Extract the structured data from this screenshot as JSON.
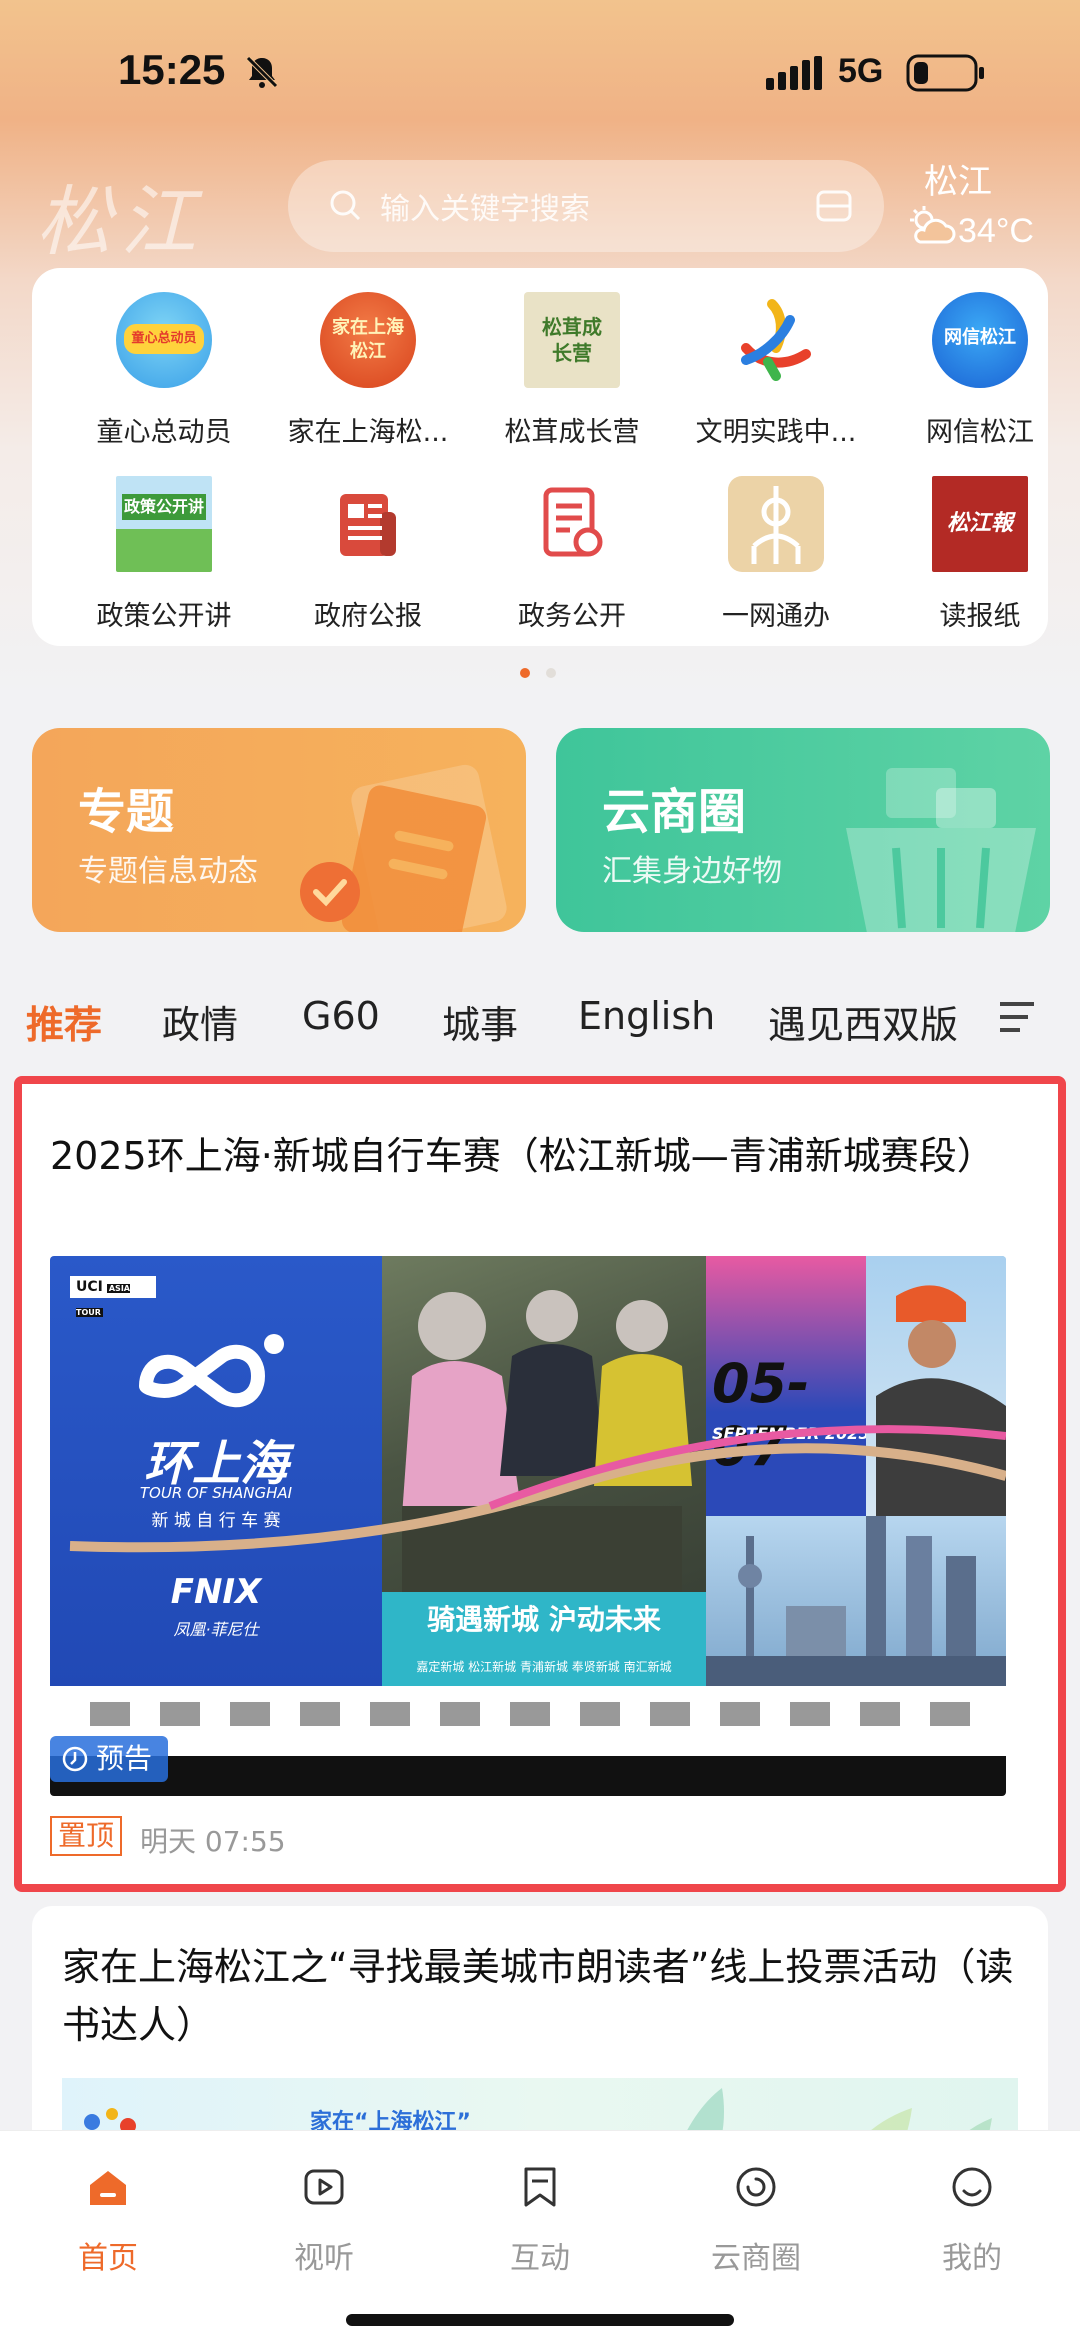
{
  "status_bar": {
    "time": "15:25",
    "network": "5G"
  },
  "header": {
    "logo_text": "松江",
    "search_placeholder": "输入关键字搜索",
    "weather": {
      "city": "松江",
      "temp": "34°C"
    }
  },
  "grid": {
    "items": [
      {
        "label": "童心总动员",
        "icon": "kids-icon"
      },
      {
        "label": "家在上海松...",
        "icon": "home-songjiang-icon"
      },
      {
        "label": "松茸成长营",
        "icon": "growth-camp-icon"
      },
      {
        "label": "文明实践中...",
        "icon": "civilization-icon"
      },
      {
        "label": "网信松江",
        "icon": "net-info-icon"
      },
      {
        "label": "政策公开讲",
        "icon": "policy-talk-icon"
      },
      {
        "label": "政府公报",
        "icon": "gov-bulletin-icon"
      },
      {
        "label": "政务公开",
        "icon": "gov-affairs-icon"
      },
      {
        "label": "一网通办",
        "icon": "one-net-icon"
      },
      {
        "label": "读报纸",
        "icon": "newspaper-icon"
      }
    ],
    "icon_texts": {
      "kids": "童心总动员",
      "home": "家在上海松江",
      "growth": "松茸成长营",
      "net": "网信松江",
      "policy": "政策公开讲",
      "newspaper": "松江報"
    }
  },
  "promos": {
    "left": {
      "title": "专题",
      "subtitle": "专题信息动态"
    },
    "right": {
      "title": "云商圈",
      "subtitle": "汇集身边好物"
    }
  },
  "tabs": {
    "items": [
      "推荐",
      "政情",
      "G60",
      "城事",
      "English",
      "遇见西双版"
    ],
    "active": "推荐"
  },
  "article1": {
    "title": "2025环上海·新城自行车赛（松江新城—青浦新城赛段）",
    "preview_label": "预告",
    "pin_label": "置顶",
    "time": "明天 07:55",
    "poster": {
      "uci": "UCI",
      "asia_tour": "ASIA TOUR",
      "brand": "环上海",
      "brand_en": "TOUR OF SHANGHAI",
      "sub": "新 城 自 行 车 赛",
      "sponsor": "FNIX",
      "sponsor_cn": "凤凰·菲尼仕",
      "date": "05-07",
      "month": "SEPTEMBER 2025",
      "slogan": "骑遇新城  沪动未来",
      "districts": "嘉定新城  松江新城  青浦新城  奉贤新城  南汇新城"
    }
  },
  "article2": {
    "title": "家在上海松江之“寻找最美城市朗读者”线上投票活动（读书达人）",
    "image_caption": "家在“上海松江”"
  },
  "bottom_nav": {
    "items": [
      {
        "label": "首页",
        "icon": "home-icon"
      },
      {
        "label": "视听",
        "icon": "play-icon"
      },
      {
        "label": "互动",
        "icon": "bookmark-icon"
      },
      {
        "label": "云商圈",
        "icon": "cloud-circle-icon"
      },
      {
        "label": "我的",
        "icon": "smile-icon"
      }
    ],
    "active": "首页"
  },
  "colors": {
    "accent": "#ee6a2a",
    "highlight_border": "#f0464b"
  }
}
